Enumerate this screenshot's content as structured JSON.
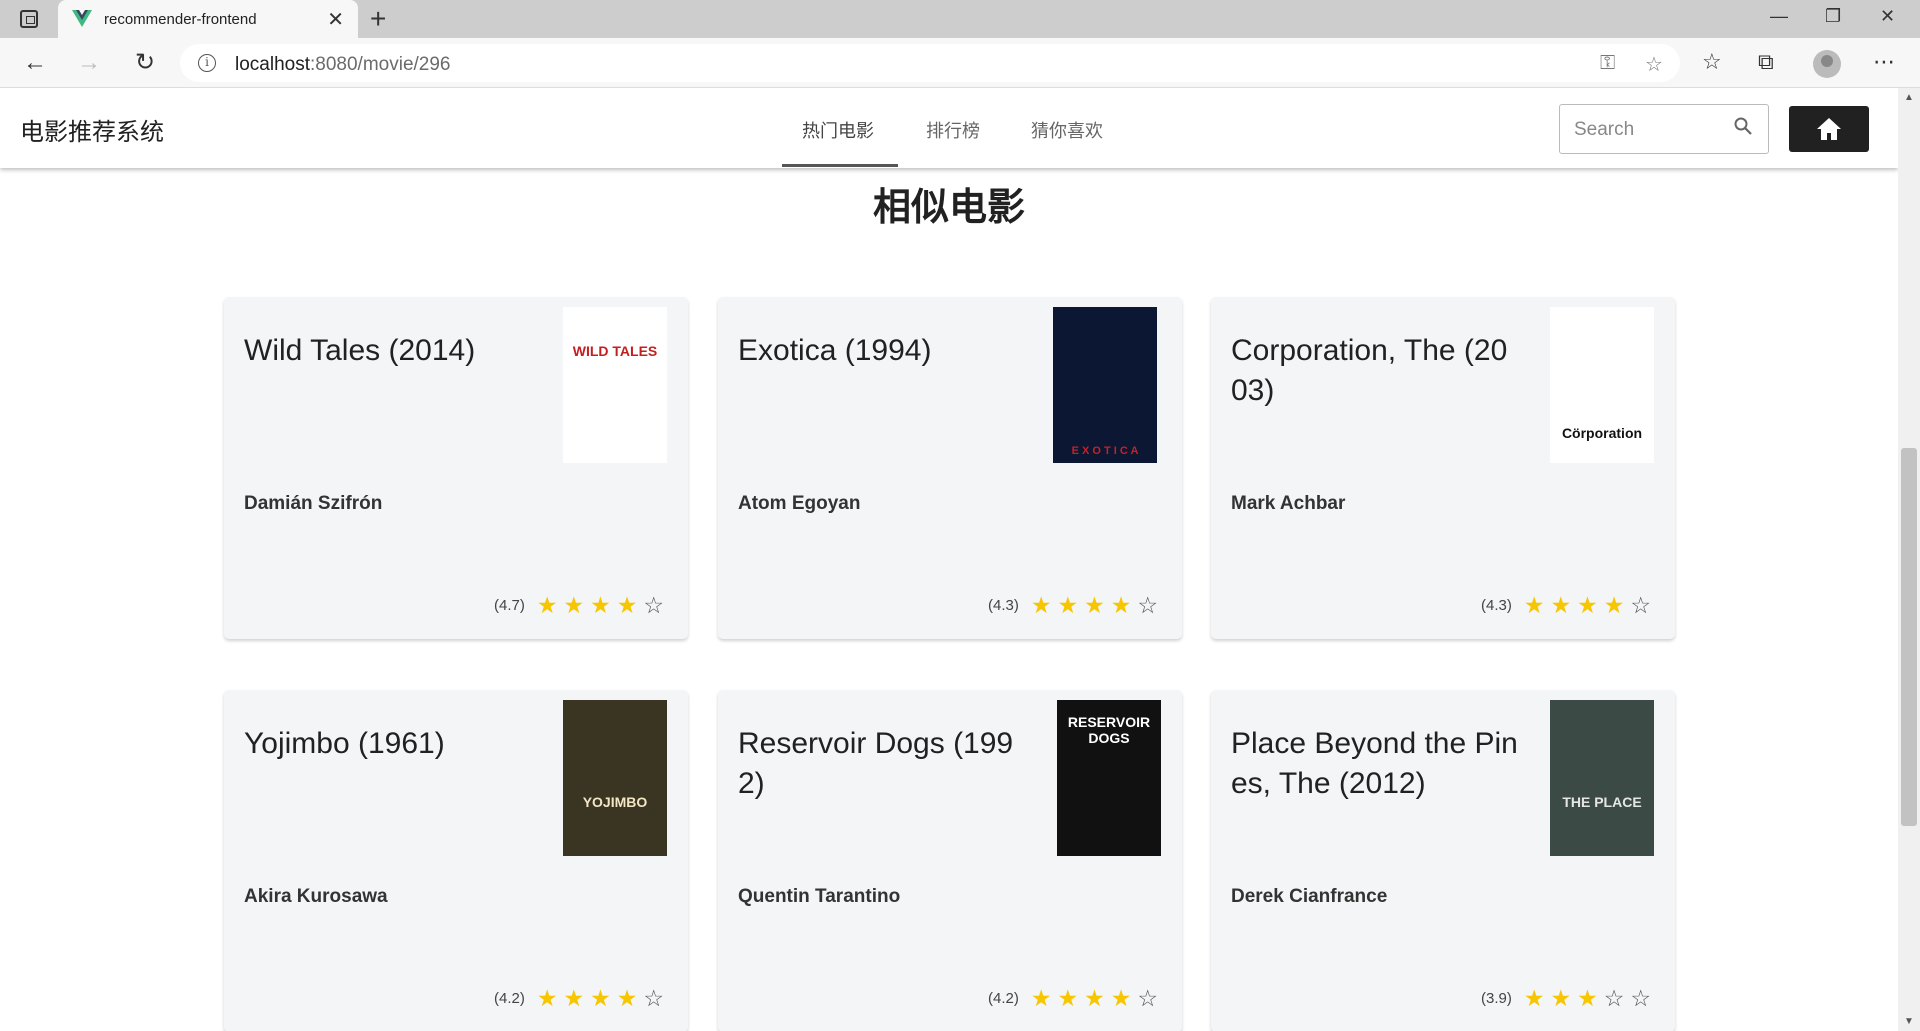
{
  "browser": {
    "tab_title": "recommender-frontend",
    "url_host": "localhost",
    "url_path": ":8080/movie/296"
  },
  "app": {
    "title": "电影推荐系统",
    "nav": [
      "热门电影",
      "排行榜",
      "猜你喜欢"
    ],
    "active_nav": 0,
    "search_placeholder": "Search"
  },
  "section_title": "相似电影",
  "movies": [
    {
      "title": "Wild Tales (2014)",
      "director": "Damián Szifrón",
      "rating": 4.7,
      "rating_text": "(4.7)",
      "stars": [
        1,
        1,
        1,
        1,
        0
      ],
      "poster": {
        "text": "WILD TALES",
        "color": "#c31f1f",
        "bg": "#ffffff"
      }
    },
    {
      "title": "Exotica (1994)",
      "director": "Atom Egoyan",
      "rating": 4.3,
      "rating_text": "(4.3)",
      "stars": [
        1,
        1,
        1,
        1,
        0
      ],
      "poster": {
        "text": "E X O T I C A",
        "color": "#c8202a",
        "bg": "#0b1733"
      }
    },
    {
      "title": "Corporation, The (2003)",
      "director": "Mark Achbar",
      "rating": 4.3,
      "rating_text": "(4.3)",
      "stars": [
        1,
        1,
        1,
        1,
        0
      ],
      "poster": {
        "text": "Cörporation",
        "color": "#111111",
        "bg": "#ffffff"
      }
    },
    {
      "title": "Yojimbo (1961)",
      "director": "Akira Kurosawa",
      "rating": 4.2,
      "rating_text": "(4.2)",
      "stars": [
        1,
        1,
        1,
        1,
        0
      ],
      "poster": {
        "text": "YOJIMBO",
        "color": "#f2e6c4",
        "bg": "#3a3422"
      }
    },
    {
      "title": "Reservoir Dogs (1992)",
      "director": "Quentin Tarantino",
      "rating": 4.2,
      "rating_text": "(4.2)",
      "stars": [
        1,
        1,
        1,
        1,
        0
      ],
      "poster": {
        "text": "RESERVOIR DOGS",
        "color": "#ffffff",
        "bg": "#111111"
      }
    },
    {
      "title": "Place Beyond the Pines, The (2012)",
      "director": "Derek Cianfrance",
      "rating": 3.9,
      "rating_text": "(3.9)",
      "stars": [
        1,
        1,
        1,
        0,
        0
      ],
      "poster": {
        "text": "THE PLACE",
        "color": "#e6e6e6",
        "bg": "#3b4a44"
      }
    }
  ],
  "colors": {
    "star_filled": "#f7c600",
    "star_empty": "#555555",
    "card_bg": "#f3f5f6"
  }
}
